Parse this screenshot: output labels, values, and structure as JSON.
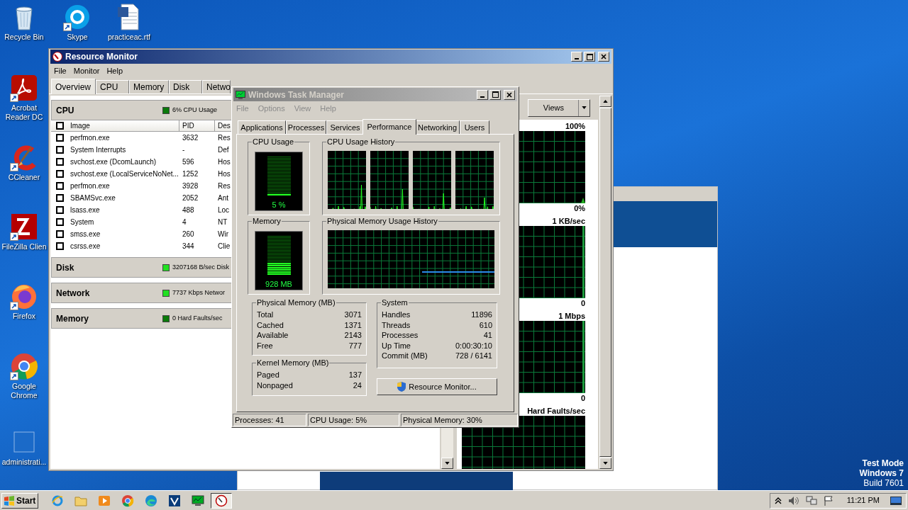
{
  "desktop_icons": [
    {
      "label": "Recycle Bin",
      "kind": "recycle",
      "shortcut": false
    },
    {
      "label": "Skype",
      "kind": "skype",
      "shortcut": true
    },
    {
      "label": "practiceac.rtf",
      "kind": "document",
      "shortcut": false
    },
    {
      "label": "Acrobat Reader DC",
      "kind": "acrobat",
      "shortcut": true
    },
    {
      "label": "CCleaner",
      "kind": "ccleaner",
      "shortcut": true
    },
    {
      "label": "FileZilla Clien",
      "kind": "filezilla",
      "shortcut": true
    },
    {
      "label": "Firefox",
      "kind": "firefox",
      "shortcut": true
    },
    {
      "label": "Google Chrome",
      "kind": "chrome",
      "shortcut": true
    },
    {
      "label": "administrati...",
      "kind": "blank",
      "shortcut": false
    }
  ],
  "resource_monitor": {
    "title": "Resource Monitor",
    "active": true,
    "menu": [
      "File",
      "Monitor",
      "Help"
    ],
    "tabs": [
      {
        "label": "Overview",
        "selected": true
      },
      {
        "label": "CPU",
        "selected": false
      },
      {
        "label": "Memory",
        "selected": false
      },
      {
        "label": "Disk",
        "selected": false
      },
      {
        "label": "Netwo",
        "selected": false
      }
    ],
    "sections": [
      {
        "title": "CPU",
        "indicator": "6% CPU Usage",
        "color": "#0a7a0a",
        "table": {
          "select_all_checked": false,
          "columns": [
            "Image",
            "PID",
            "Des"
          ],
          "rows": [
            {
              "image": "perfmon.exe",
              "pid": "3632",
              "description": "Res",
              "checked": false
            },
            {
              "image": "System Interrupts",
              "pid": "-",
              "description": "Def",
              "checked": false
            },
            {
              "image": "svchost.exe (DcomLaunch)",
              "pid": "596",
              "description": "Hos",
              "checked": false
            },
            {
              "image": "svchost.exe (LocalServiceNoNet...",
              "pid": "1252",
              "description": "Hos",
              "checked": false
            },
            {
              "image": "perfmon.exe",
              "pid": "3928",
              "description": "Res",
              "checked": false
            },
            {
              "image": "SBAMSvc.exe",
              "pid": "2052",
              "description": "Ant",
              "checked": false
            },
            {
              "image": "lsass.exe",
              "pid": "488",
              "description": "Loc",
              "checked": false
            },
            {
              "image": "System",
              "pid": "4",
              "description": "NT",
              "checked": false
            },
            {
              "image": "smss.exe",
              "pid": "260",
              "description": "Wir",
              "checked": false
            },
            {
              "image": "csrss.exe",
              "pid": "344",
              "description": "Clie",
              "checked": false
            }
          ]
        }
      },
      {
        "title": "Disk",
        "indicator": "3207168 B/sec Disk",
        "color": "#22e022"
      },
      {
        "title": "Network",
        "indicator": "7737 Kbps Networ",
        "color": "#22e022"
      },
      {
        "title": "Memory",
        "indicator": "0 Hard Faults/sec",
        "color": "#0a7a0a"
      }
    ],
    "views_button": "Views",
    "graphs": [
      {
        "top_label": "100%",
        "bottom_label": "0%"
      },
      {
        "top_label": "1 KB/sec",
        "bottom_label": "0"
      },
      {
        "top_label": "1 Mbps",
        "bottom_label": "0"
      },
      {
        "top_label": "Hard Faults/sec"
      }
    ]
  },
  "task_manager": {
    "title": "Windows Task Manager",
    "active": false,
    "menu": [
      "File",
      "Options",
      "View",
      "Help"
    ],
    "tabs": [
      {
        "label": "Applications",
        "selected": false
      },
      {
        "label": "Processes",
        "selected": false
      },
      {
        "label": "Services",
        "selected": false
      },
      {
        "label": "Performance",
        "selected": true
      },
      {
        "label": "Networking",
        "selected": false
      },
      {
        "label": "Users",
        "selected": false
      }
    ],
    "cpu_usage": {
      "title": "CPU Usage",
      "reading": "5 %",
      "level": 0.05
    },
    "cpu_history": {
      "title": "CPU Usage History"
    },
    "memory": {
      "title": "Memory",
      "reading": "928 MB",
      "level": 0.3
    },
    "memory_history": {
      "title": "Physical Memory Usage History"
    },
    "physical_memory": {
      "title": "Physical Memory (MB)",
      "rows": [
        {
          "label": "Total",
          "value": "3071"
        },
        {
          "label": "Cached",
          "value": "1371"
        },
        {
          "label": "Available",
          "value": "2143"
        },
        {
          "label": "Free",
          "value": "777"
        }
      ]
    },
    "kernel_memory": {
      "title": "Kernel Memory (MB)",
      "rows": [
        {
          "label": "Paged",
          "value": "137"
        },
        {
          "label": "Nonpaged",
          "value": "24"
        }
      ]
    },
    "system": {
      "title": "System",
      "rows": [
        {
          "label": "Handles",
          "value": "11896"
        },
        {
          "label": "Threads",
          "value": "610"
        },
        {
          "label": "Processes",
          "value": "41"
        },
        {
          "label": "Up Time",
          "value": "0:00:30:10"
        },
        {
          "label": "Commit (MB)",
          "value": "728 / 6141"
        }
      ]
    },
    "resource_monitor_button": "Resource Monitor...",
    "status_bar": [
      "Processes: 41",
      "CPU Usage: 5%",
      "Physical Memory: 30%"
    ]
  },
  "taskbar": {
    "start": "Start",
    "items": [
      {
        "kind": "ie",
        "active": false
      },
      {
        "kind": "folder",
        "active": false
      },
      {
        "kind": "media",
        "active": false
      },
      {
        "kind": "chrome",
        "active": false
      },
      {
        "kind": "edge",
        "active": false
      },
      {
        "kind": "vpn",
        "active": false
      },
      {
        "kind": "taskmgr",
        "active": false
      },
      {
        "kind": "resmon",
        "active": true
      }
    ],
    "clock": "11:21 PM"
  },
  "desktop_notice": [
    "Test Mode",
    "Windows 7",
    "Build 7601"
  ]
}
